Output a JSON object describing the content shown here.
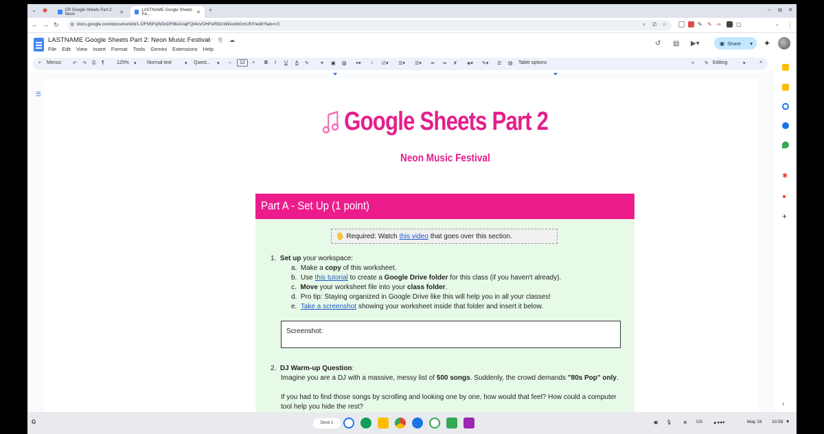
{
  "browser": {
    "tabs": [
      {
        "label": "CR Google Sheets Part 2: Neon"
      },
      {
        "label": "LASTNAME Google Sheets Pa..."
      }
    ],
    "url": "docs.google.com/document/d/1-OFN5FqW3xDF8bAUajFQl4sVOHFeRlDcWlAshbGmU5Y/edit?tab=t.0"
  },
  "docs": {
    "title": "LASTNAME Google Sheets Part 2: Neon Music Festival",
    "menu": [
      "File",
      "Edit",
      "View",
      "Insert",
      "Format",
      "Tools",
      "Gemini",
      "Extensions",
      "Help"
    ],
    "share_label": "Share",
    "toolbar": {
      "menus": "Menus",
      "zoom": "125%",
      "style": "Normal text",
      "font": "Quest...",
      "font_size": "12",
      "table_options": "Table options",
      "mode": "Editing"
    }
  },
  "document": {
    "title": "Google Sheets Part 2",
    "subtitle": "Neon Music Festival",
    "section_title": "Part A - Set Up (1 point)",
    "required": {
      "prefix": "Required: Watch",
      "link": "this video",
      "suffix": "that goes over this section."
    },
    "q1": {
      "num": "1.",
      "bold": "Set up",
      "rest": "your workspace:",
      "a": {
        "label": "a.",
        "t1": "Make a",
        "b1": "copy",
        "t2": "of this worksheet."
      },
      "b": {
        "label": "b.",
        "t1": "Use",
        "link": "this tutorial",
        "t2": "to create a",
        "b1": "Google Drive folder",
        "t3": "for this class (if you haven't already)."
      },
      "c": {
        "label": "c.",
        "b1": "Move",
        "t1": "your worksheet file into your",
        "b2": "class folder",
        "t2": "."
      },
      "d": {
        "label": "d.",
        "t1": "Pro tip: Staying organized in Google Drive like this will help you in all your classes!"
      },
      "e": {
        "label": "e.",
        "link": "Take a screenshot",
        "t1": "showing your worksheet inside that folder and insert it below."
      }
    },
    "screenshot_label": "Screenshot:",
    "q2": {
      "num": "2.",
      "bold": "DJ Warm-up Question",
      "colon": ":",
      "line1_a": "Imagine you are a DJ with a massive, messy list of",
      "line1_b": "500 songs",
      "line1_c": ". Suddenly, the crowd demands",
      "line1_d": "\"80s Pop\" only",
      "line1_e": ".",
      "line2": "If you had to find those songs by scrolling and looking one by one, how would that feel? How could a computer",
      "line3": "tool help you hide the rest?"
    }
  },
  "shelf": {
    "desk": "Desk 1",
    "locale": "US",
    "date": "May 19",
    "time": "10:58"
  },
  "colors": {
    "accent": "#ec1c8c",
    "section_bg": "#e7f9e7",
    "share": "#c2e7ff"
  }
}
